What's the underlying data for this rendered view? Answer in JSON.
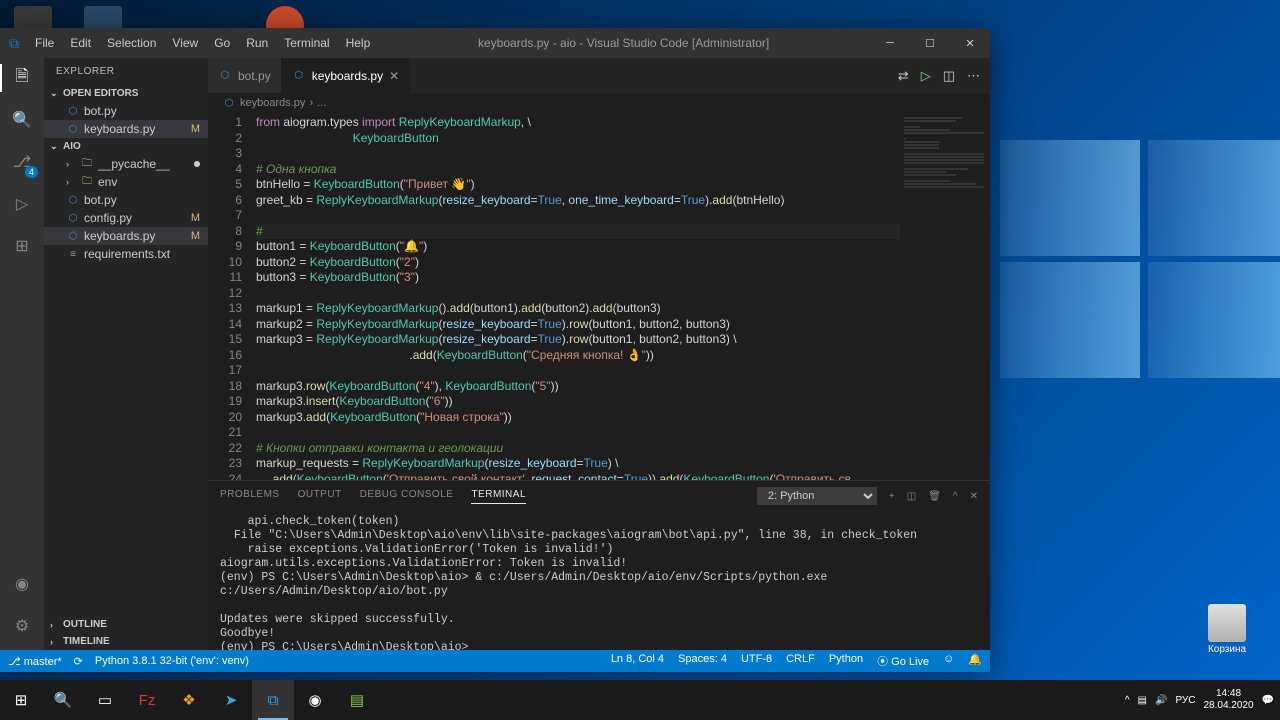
{
  "desktop": {
    "recycle_label": "Корзина"
  },
  "titlebar": {
    "menu": [
      "File",
      "Edit",
      "Selection",
      "View",
      "Go",
      "Run",
      "Terminal",
      "Help"
    ],
    "title": "keyboards.py - aio - Visual Studio Code [Administrator]"
  },
  "sidebar": {
    "title": "EXPLORER",
    "open_editors_label": "OPEN EDITORS",
    "open_editors": [
      "bot.py",
      "keyboards.py"
    ],
    "folder_label": "AIO",
    "items": [
      {
        "name": "__pycache__",
        "type": "folder",
        "mod": "",
        "dot": true
      },
      {
        "name": "env",
        "type": "folder"
      },
      {
        "name": "bot.py",
        "type": "py"
      },
      {
        "name": "config.py",
        "type": "py",
        "mod": "M"
      },
      {
        "name": "keyboards.py",
        "type": "py",
        "mod": "M",
        "selected": true
      },
      {
        "name": "requirements.txt",
        "type": "txt"
      }
    ],
    "outline": "OUTLINE",
    "timeline": "TIMELINE",
    "scm_badge": "4"
  },
  "tabs": {
    "items": [
      {
        "label": "bot.py",
        "active": false
      },
      {
        "label": "keyboards.py",
        "active": true
      }
    ]
  },
  "breadcrumb": {
    "file": "keyboards.py",
    "sep": "›",
    "more": "..."
  },
  "code": {
    "lines": [
      {
        "n": 1,
        "html": "<span class='kw'>from</span> aiogram.types <span class='kw'>import</span> <span class='cls'>ReplyKeyboardMarkup</span>, \\"
      },
      {
        "n": 2,
        "html": "                             <span class='cls'>KeyboardButton</span>"
      },
      {
        "n": 3,
        "html": ""
      },
      {
        "n": 4,
        "html": "<span class='cmt'># Одна кнопка</span>"
      },
      {
        "n": 5,
        "html": "btnHello = <span class='cls'>KeyboardButton</span>(<span class='str'>\"Привет 👋\"</span>)"
      },
      {
        "n": 6,
        "html": "greet_kb = <span class='cls'>ReplyKeyboardMarkup</span>(<span class='param'>resize_keyboard</span>=<span class='bool'>True</span>, <span class='param'>one_time_keyboard</span>=<span class='bool'>True</span>).<span class='fn'>add</span>(btnHello)"
      },
      {
        "n": 7,
        "html": ""
      },
      {
        "n": 8,
        "html": "<span class='cmt'># </span>",
        "current": true
      },
      {
        "n": 9,
        "html": "button1 = <span class='cls'>KeyboardButton</span>(<span class='str'>\"🔔\"</span>)"
      },
      {
        "n": 10,
        "html": "button2 = <span class='cls'>KeyboardButton</span>(<span class='str'>\"2\"</span>)"
      },
      {
        "n": 11,
        "html": "button3 = <span class='cls'>KeyboardButton</span>(<span class='str'>\"3\"</span>)"
      },
      {
        "n": 12,
        "html": ""
      },
      {
        "n": 13,
        "html": "markup1 = <span class='cls'>ReplyKeyboardMarkup</span>().<span class='fn'>add</span>(button1).<span class='fn'>add</span>(button2).<span class='fn'>add</span>(button3)"
      },
      {
        "n": 14,
        "html": "markup2 = <span class='cls'>ReplyKeyboardMarkup</span>(<span class='param'>resize_keyboard</span>=<span class='bool'>True</span>).<span class='fn'>row</span>(button1, button2, button3)"
      },
      {
        "n": 15,
        "html": "markup3 = <span class='cls'>ReplyKeyboardMarkup</span>(<span class='param'>resize_keyboard</span>=<span class='bool'>True</span>).<span class='fn'>row</span>(button1, button2, button3) \\"
      },
      {
        "n": 16,
        "html": "                                              .<span class='fn'>add</span>(<span class='cls'>KeyboardButton</span>(<span class='str'>\"Средняя кнопка! 👌\"</span>))"
      },
      {
        "n": 17,
        "html": ""
      },
      {
        "n": 18,
        "html": "markup3.<span class='fn'>row</span>(<span class='cls'>KeyboardButton</span>(<span class='str'>\"4\"</span>), <span class='cls'>KeyboardButton</span>(<span class='str'>\"5\"</span>))"
      },
      {
        "n": 19,
        "html": "markup3.<span class='fn'>insert</span>(<span class='cls'>KeyboardButton</span>(<span class='str'>\"6\"</span>))"
      },
      {
        "n": 20,
        "html": "markup3.<span class='fn'>add</span>(<span class='cls'>KeyboardButton</span>(<span class='str'>\"Новая строка\"</span>))"
      },
      {
        "n": 21,
        "html": ""
      },
      {
        "n": 22,
        "html": "<span class='cmt'># Кнопки отправки контакта и геолокации</span>"
      },
      {
        "n": 23,
        "html": "markup_requests = <span class='cls'>ReplyKeyboardMarkup</span>(<span class='param'>resize_keyboard</span>=<span class='bool'>True</span>) \\"
      },
      {
        "n": 24,
        "html": "    .<span class='fn'>add</span>(<span class='cls'>KeyboardButton</span>(<span class='str'>'Отправить свой контакт'</span>, <span class='param'>request_contact</span>=<span class='bool'>True</span>)).<span class='fn'>add</span>(<span class='cls'>KeyboardButton</span>(<span class='str'>'Отправить св</span>"
      }
    ]
  },
  "panel": {
    "tabs": [
      "PROBLEMS",
      "OUTPUT",
      "DEBUG CONSOLE",
      "TERMINAL"
    ],
    "active": "TERMINAL",
    "selector": "2: Python",
    "terminal_text": "    api.check_token(token)\n  File \"C:\\Users\\Admin\\Desktop\\aio\\env\\lib\\site-packages\\aiogram\\bot\\api.py\", line 38, in check_token\n    raise exceptions.ValidationError('Token is invalid!')\naiogram.utils.exceptions.ValidationError: Token is invalid!\n(env) PS C:\\Users\\Admin\\Desktop\\aio> & c:/Users/Admin/Desktop/aio/env/Scripts/python.exe c:/Users/Admin/Desktop/aio/bot.py\n\nUpdates were skipped successfully.\nGoodbye!\n(env) PS C:\\Users\\Admin\\Desktop\\aio> "
  },
  "statusbar": {
    "branch": "master*",
    "python": "Python 3.8.1 32-bit ('env': venv)",
    "position": "Ln 8, Col 4",
    "spaces": "Spaces: 4",
    "encoding": "UTF-8",
    "eol": "CRLF",
    "lang": "Python",
    "golive": "⦿ Go Live",
    "bell": "🔔"
  },
  "taskbar": {
    "lang": "РУС",
    "time": "14:48",
    "date": "28.04.2020"
  }
}
